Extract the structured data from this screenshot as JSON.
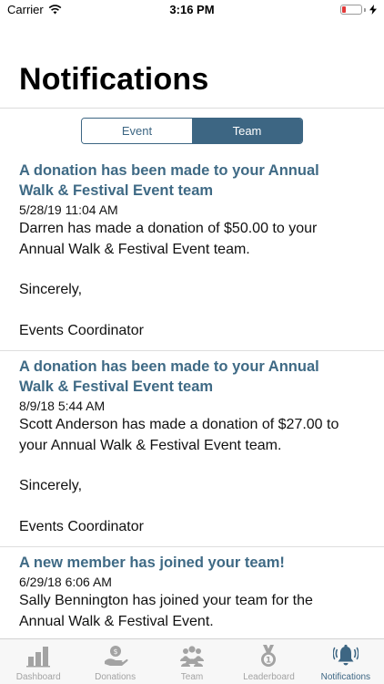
{
  "status_bar": {
    "carrier": "Carrier",
    "time": "3:16 PM"
  },
  "header": {
    "title": "Notifications"
  },
  "segmented_control": {
    "segments": [
      {
        "label": "Event",
        "selected": false
      },
      {
        "label": "Team",
        "selected": true
      }
    ]
  },
  "notifications": [
    {
      "title": "A donation has been made to your Annual Walk & Festival Event team",
      "date": "5/28/19 11:04 AM",
      "body": "Darren  has made a donation of $50.00 to your Annual Walk & Festival Event team.",
      "closing": "Sincerely,",
      "signature": "Events Coordinator"
    },
    {
      "title": "A donation has been made to your Annual Walk & Festival Event team",
      "date": "8/9/18 5:44 AM",
      "body": "Scott Anderson  has made a donation of $27.00 to your Annual Walk & Festival Event team.",
      "closing": "Sincerely,",
      "signature": "Events Coordinator"
    },
    {
      "title": "A new member has joined your team!",
      "date": "6/29/18 6:06 AM",
      "body": "Sally Bennington has joined your team for the Annual Walk & Festival Event.",
      "closing": "",
      "signature": ""
    }
  ],
  "tab_bar": {
    "items": [
      {
        "label": "Dashboard",
        "icon": "bar-chart-icon",
        "active": false
      },
      {
        "label": "Donations",
        "icon": "donation-hand-icon",
        "active": false
      },
      {
        "label": "Team",
        "icon": "team-people-icon",
        "active": false
      },
      {
        "label": "Leaderboard",
        "icon": "medal-icon",
        "active": false
      },
      {
        "label": "Notifications",
        "icon": "bell-icon",
        "active": true
      }
    ]
  },
  "colors": {
    "accent": "#3d6683",
    "title_text": "#3f6a85",
    "inactive_tab": "#a3a3a3",
    "battery_low": "#e23a3a"
  }
}
